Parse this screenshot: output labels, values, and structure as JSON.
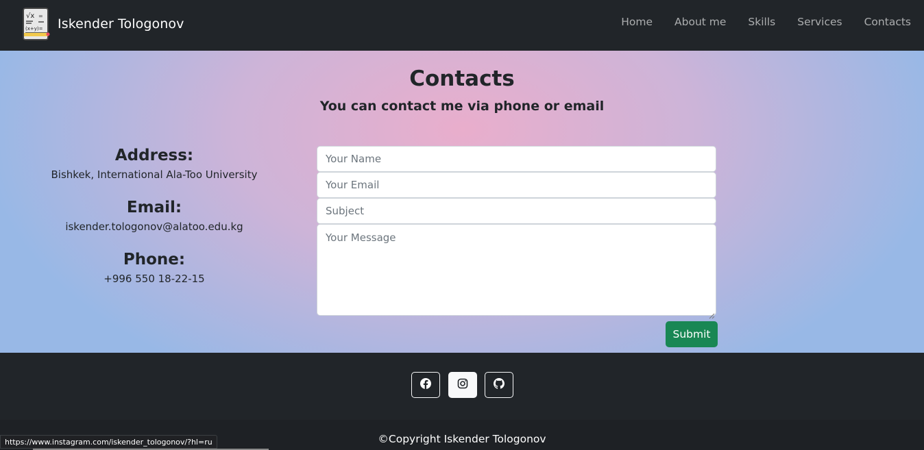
{
  "navbar": {
    "brand": "Iskender Tologonov",
    "links": [
      "Home",
      "About me",
      "Skills",
      "Services",
      "Contacts"
    ]
  },
  "contacts": {
    "title": "Contacts",
    "subtitle": "You can contact me via phone or email",
    "address_label": "Address:",
    "address_value": "Bishkek, International Ala-Too University",
    "email_label": "Email:",
    "email_value": "iskender.tologonov@alatoo.edu.kg",
    "phone_label": "Phone:",
    "phone_value": "+996 550 18-22-15"
  },
  "form": {
    "name_placeholder": "Your Name",
    "email_placeholder": "Your Email",
    "subject_placeholder": "Subject",
    "message_placeholder": "Your Message",
    "submit_label": "Submit"
  },
  "footer": {
    "social_icons": [
      "facebook-icon",
      "instagram-icon",
      "github-icon"
    ],
    "copyright": "©Copyright Iskender Tologonov"
  },
  "statusbar": {
    "url": "https://www.instagram.com/iskender_tologonov/?hl=ru"
  },
  "colors": {
    "navbar_bg": "#212529",
    "submit_bg": "#198754",
    "gradient_center": "#e9aecc",
    "gradient_edge": "#98b8e6"
  }
}
